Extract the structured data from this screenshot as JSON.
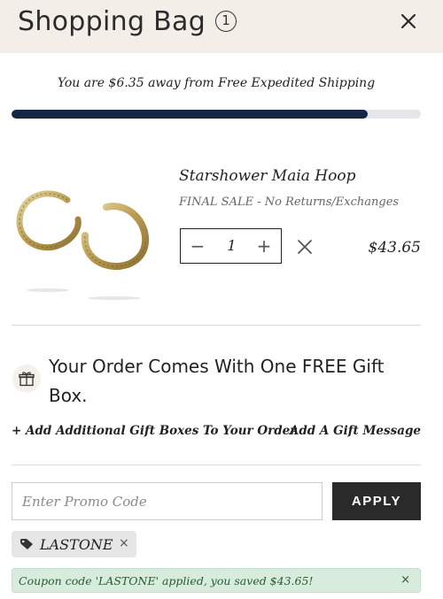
{
  "header": {
    "title": "Shopping Bag",
    "item_count": "1",
    "close_icon": "close-icon"
  },
  "shipping": {
    "message": "You are $6.35 away from Free Expedited Shipping",
    "progress_fraction": 0.87
  },
  "product": {
    "image_icon": "hoop-earrings-image",
    "name": "Starshower Maia Hoop",
    "note": "FINAL SALE - No Returns/Exchanges",
    "quantity": "1",
    "minus_label": "−",
    "plus_label": "+",
    "price": "$43.65"
  },
  "gift": {
    "icon": "gift-icon",
    "message": "Your Order Comes With One FREE Gift Box.",
    "add_boxes_link": "+ Add Additional Gift Boxes To Your Order",
    "add_message_link": "Add A Gift Message"
  },
  "promo": {
    "placeholder": "Enter Promo Code",
    "value": "",
    "apply_label": "APPLY",
    "applied_code": "LASTONE",
    "remove_code_label": "×",
    "applied_message": "Coupon code 'LASTONE' applied, you saved $43.65!",
    "dismiss_label": "×"
  },
  "colors": {
    "header_bg": "#f3efe8",
    "progress_fill": "#142643",
    "apply_bg": "#2a2a2a",
    "success_bg": "#d8ecde"
  }
}
